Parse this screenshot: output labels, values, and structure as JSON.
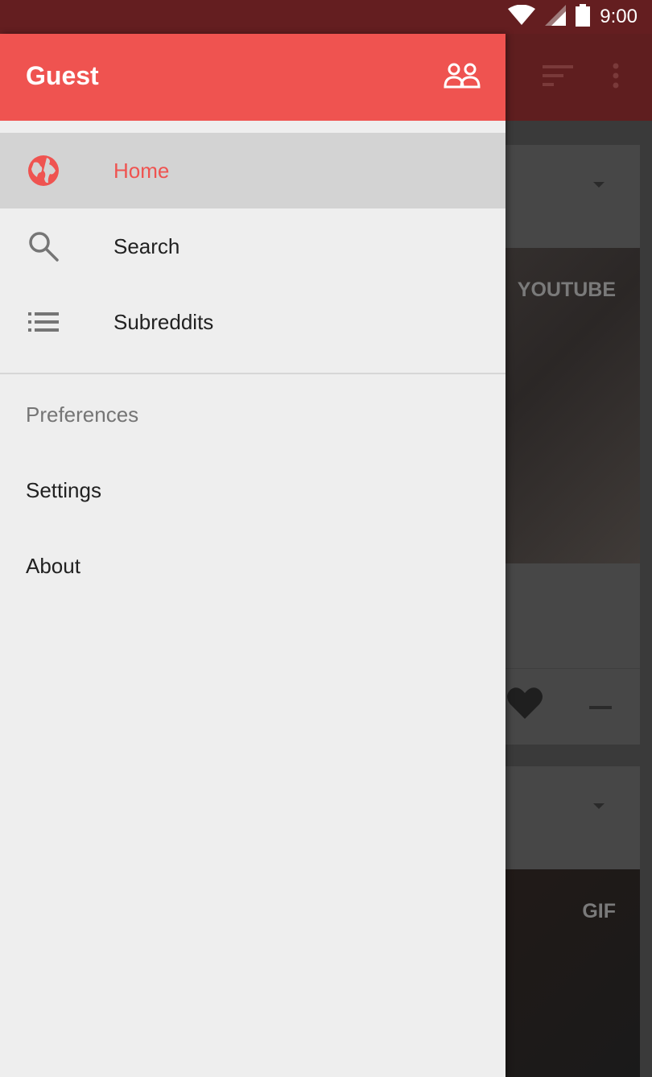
{
  "status_bar": {
    "time": "9:00",
    "icons": [
      "wifi-icon",
      "cell-signal-icon",
      "battery-icon"
    ]
  },
  "drawer": {
    "title": "Guest",
    "accounts_icon": "accounts-icon",
    "nav_items": [
      {
        "label": "Home",
        "icon": "globe-icon",
        "active": true
      },
      {
        "label": "Search",
        "icon": "search-icon",
        "active": false
      },
      {
        "label": "Subreddits",
        "icon": "list-icon",
        "active": false
      }
    ],
    "section_header": "Preferences",
    "preference_items": [
      {
        "label": "Settings"
      },
      {
        "label": "About"
      }
    ]
  },
  "background": {
    "toolbar_icons": [
      "sort-icon",
      "more-vert-icon"
    ],
    "cards": [
      {
        "tag": "YOUTUBE"
      },
      {
        "tag": "GIF"
      }
    ]
  },
  "colors": {
    "accent": "#ef5350",
    "status_bar": "#641e20",
    "drawer_bg": "#eeeeee",
    "active_item_bg": "#d3d3d3"
  }
}
